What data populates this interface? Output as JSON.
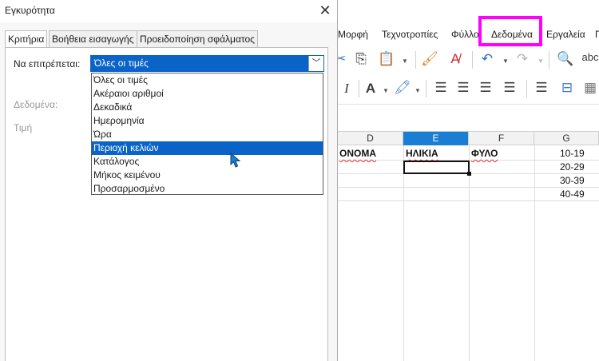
{
  "menubar": {
    "items": [
      {
        "label": "Μορφή"
      },
      {
        "label": "Τεχνοτροπίες"
      },
      {
        "label": "Φύλλο"
      },
      {
        "label": "Δεδομένα"
      },
      {
        "label": "Εργαλεία"
      },
      {
        "label": "Π"
      }
    ],
    "highlight_color": "#ff00ff"
  },
  "sheet": {
    "columns": [
      {
        "label": "D"
      },
      {
        "label": "E"
      },
      {
        "label": "F"
      },
      {
        "label": "G"
      }
    ],
    "selected_column": "E",
    "headers": {
      "d": "ΟΝΟΜΑ",
      "e": "ΗΛΙΚΙΑ",
      "f": "ΦΥΛΟ"
    },
    "age_groups": [
      "10-19",
      "20-29",
      "30-39",
      "40-49"
    ]
  },
  "dialog": {
    "title": "Εγκυρότητα",
    "close_icon": "close-icon",
    "tabs": [
      {
        "label": "Κριτήρια",
        "active": true
      },
      {
        "label": "Βοήθεια εισαγωγής",
        "active": false
      },
      {
        "label": "Προειδοποίηση σφάλματος",
        "active": false
      }
    ],
    "allow_label": "Να επιτρέπεται:",
    "data_label": "Δεδομένα:",
    "value_label": "Τιμή",
    "allow_value": "Όλες οι τιμές",
    "options": [
      "Όλες οι τιμές",
      "Ακέραιοι αριθμοί",
      "Δεκαδικά",
      "Ημερομηνία",
      "Ώρα",
      "Περιοχή κελιών",
      "Κατάλογος",
      "Μήκος κειμένου",
      "Προσαρμοσμένο"
    ],
    "highlighted_option": "Περιοχή κελιών",
    "accent_color": "#0a64c8"
  }
}
